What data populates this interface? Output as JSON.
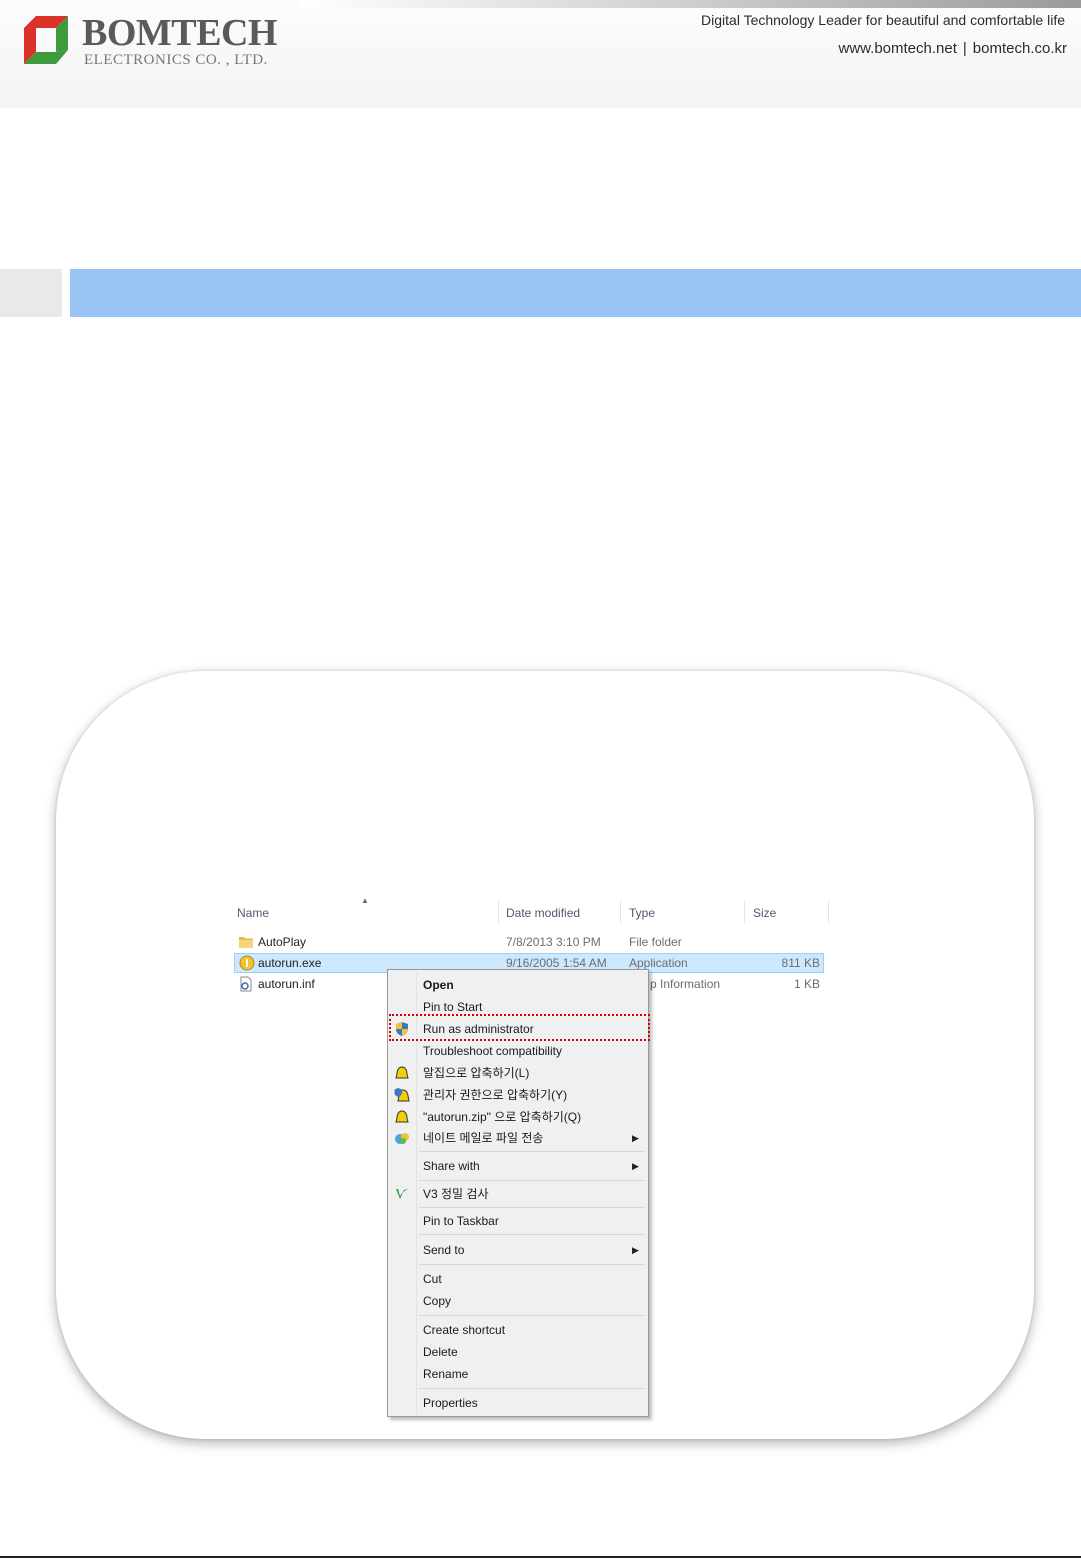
{
  "header": {
    "brand": "BOMTECH",
    "brand_sub": "ELECTRONICS CO. , LTD.",
    "tagline": "Digital Technology Leader for beautiful and comfortable life",
    "site1": "www.bomtech.net",
    "divider": "|",
    "site2": "bomtech.co.kr",
    "colors": {
      "section_bar": "#98c3f2",
      "logo_red": "#d9322a",
      "logo_green": "#3f9a3d"
    }
  },
  "explorer": {
    "columns": {
      "name": "Name",
      "date": "Date modified",
      "type": "Type",
      "size": "Size"
    },
    "rows": [
      {
        "name": "AutoPlay",
        "date": "7/8/2013 3:10 PM",
        "type": "File folder",
        "size": "",
        "icon": "folder-icon"
      },
      {
        "name": "autorun.exe",
        "date": "9/16/2005 1:54 AM",
        "type": "Application",
        "size": "811 KB",
        "icon": "application-icon",
        "selected": true
      },
      {
        "name": "autorun.inf",
        "date": "",
        "type": "p Information",
        "size": "1 KB",
        "icon": "setup-information-icon"
      }
    ]
  },
  "context_menu": {
    "open": "Open",
    "pin_start": "Pin to Start",
    "run_admin": "Run as administrator",
    "troubleshoot": "Troubleshoot compatibility",
    "alzip_compress": "알집으로 압축하기(L)",
    "admin_compress": "관리자 권한으로 압축하기(Y)",
    "zip_compress": "\"autorun.zip\" 으로 압축하기(Q)",
    "nate_mail": "네이트 메일로 파일 전송",
    "share_with": "Share with",
    "v3_scan": "V3 정밀 검사",
    "pin_taskbar": "Pin to Taskbar",
    "send_to": "Send to",
    "cut": "Cut",
    "copy": "Copy",
    "create_shortcut": "Create shortcut",
    "delete": "Delete",
    "rename": "Rename",
    "properties": "Properties",
    "submenu_arrow": "▶"
  }
}
